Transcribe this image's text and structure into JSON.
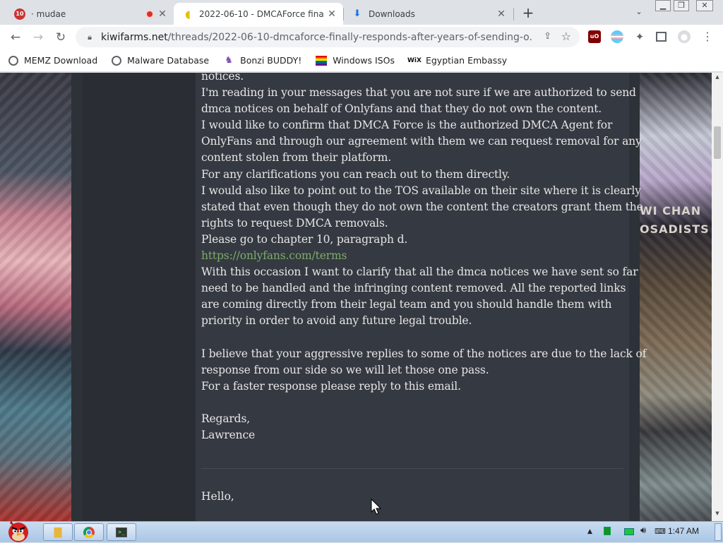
{
  "browser": {
    "tabs": [
      {
        "title": "· mudae",
        "favicon": "mudae-icon"
      },
      {
        "title": "2022-06-10 - DMCAForce fina",
        "favicon": "kiwi-icon",
        "active": true
      },
      {
        "title": "Downloads",
        "favicon": "download-icon"
      }
    ],
    "new_tab": "+",
    "url": {
      "host": "kiwifarms.net",
      "path": "/threads/2022-06-10-dmcaforce-finally-responds-after-years-of-sending-o..."
    },
    "bookmarks": [
      {
        "label": "MEMZ Download",
        "icon": "globe-icon"
      },
      {
        "label": "Malware Database",
        "icon": "globe-icon"
      },
      {
        "label": "Bonzi BUDDY!",
        "icon": "bonzi-icon"
      },
      {
        "label": "Windows ISOs",
        "icon": "rainbow-flag-icon"
      },
      {
        "label": "Egyptian Embassy",
        "icon": "wix-icon"
      }
    ]
  },
  "post": {
    "lines": [
      "notices.",
      "I'm reading in your messages that you are not sure if we are authorized to send",
      "dmca notices on behalf of Onlyfans and that they do not own the content.",
      "I would like to confirm that DMCA Force is the authorized DMCA Agent for",
      "OnlyFans and through our agreement with them we can request removal for any",
      "content stolen from their platform.",
      "For any clarifications you can reach out to them directly.",
      "I would also like to point out to the TOS available on their site where it is clearly",
      "stated that even though they do not own the content the creators grant them the",
      "rights to request DMCA removals.",
      "Please go to chapter 10, paragraph d.",
      "https://onlyfans.com/terms",
      "With this occasion I want to clarify that all the dmca notices we have sent so far",
      "need to be handled and the infringing content removed. All the reported links",
      "are coming directly from their legal team and you should handle them with",
      "priority in order to avoid any future legal trouble.",
      "",
      "I believe that your aggressive replies to some of the notices are due to the lack of",
      "response from our side so we will let those one pass.",
      "For a faster response please reply to this email.",
      "",
      "Regards,",
      "Lawrence"
    ],
    "link_line_index": 11,
    "next_greeting": "Hello,"
  },
  "background_banner": [
    "WI CHAN",
    "OSADISTS"
  ],
  "taskbar": {
    "clock": "1:47 AM"
  },
  "colors": {
    "page_bg": "#2b2f36",
    "post_bg": "#353941",
    "text": "#e6e6e6",
    "link": "#7cad6a"
  }
}
